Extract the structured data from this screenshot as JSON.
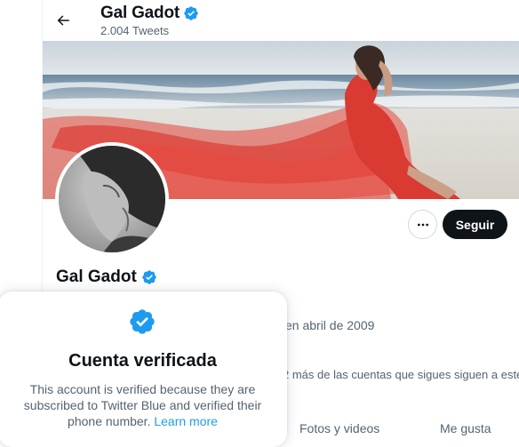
{
  "header": {
    "name": "Gal Gadot",
    "tweet_count": "2.004 Tweets"
  },
  "profile": {
    "name": "Gal Gadot",
    "handle_fragment": "",
    "joined": "en abril de 2009",
    "followers_note": "2 más de las cuentas que sigues siguen a este"
  },
  "actions": {
    "follow_label": "Seguir"
  },
  "tabs": [
    {
      "label": "Fotos y videos"
    },
    {
      "label": "Me gusta"
    }
  ],
  "popup": {
    "title": "Cuenta verificada",
    "body": "This account is verified because they are subscribed to Twitter Blue and verified their phone number.",
    "link": "Learn more"
  },
  "colors": {
    "accent": "#1d9bf0",
    "text_primary": "#0f1419",
    "text_secondary": "#536471"
  },
  "icons": [
    "back-arrow-icon",
    "verified-badge-icon",
    "more-options-icon"
  ]
}
